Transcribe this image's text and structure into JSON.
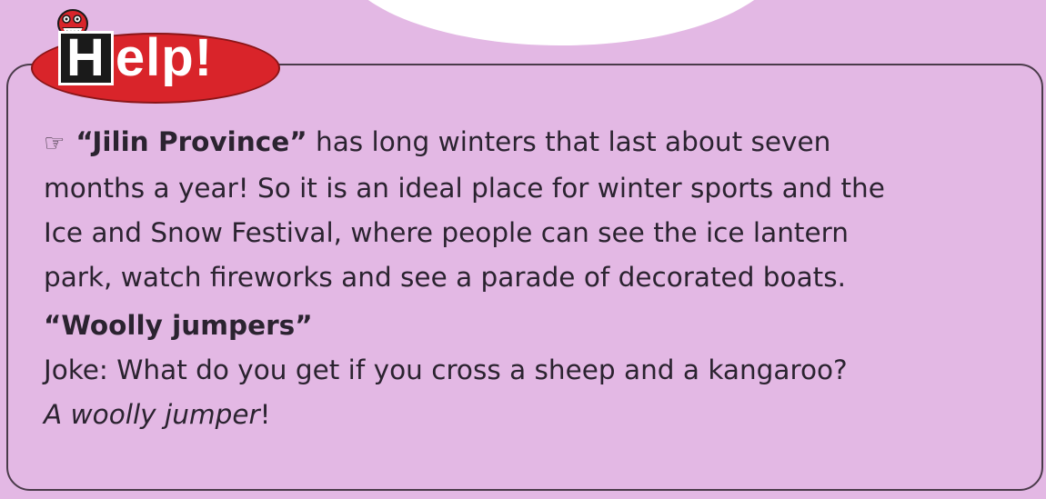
{
  "badge": {
    "first_letter": "H",
    "rest": "elp!"
  },
  "paragraph1": {
    "pointer_icon": "pointing-hand-icon",
    "term": "“Jilin Province”",
    "text_line1": " has long winters that last about seven",
    "line2": "months a year! So it is an ideal place for winter sports and the",
    "line3": "Ice and Snow Festival, where people can see the ice lantern",
    "line4": "park, watch fireworks and see a parade of decorated boats."
  },
  "paragraph2": {
    "term": "“Woolly jumpers”",
    "joke": "Joke: What do you get if you cross a sheep and a kangaroo?",
    "answer": "A woolly jumper",
    "answer_end": "!"
  },
  "colors": {
    "background": "#e3b8e4",
    "badge": "#d9242a",
    "border": "#4a3b4a"
  }
}
